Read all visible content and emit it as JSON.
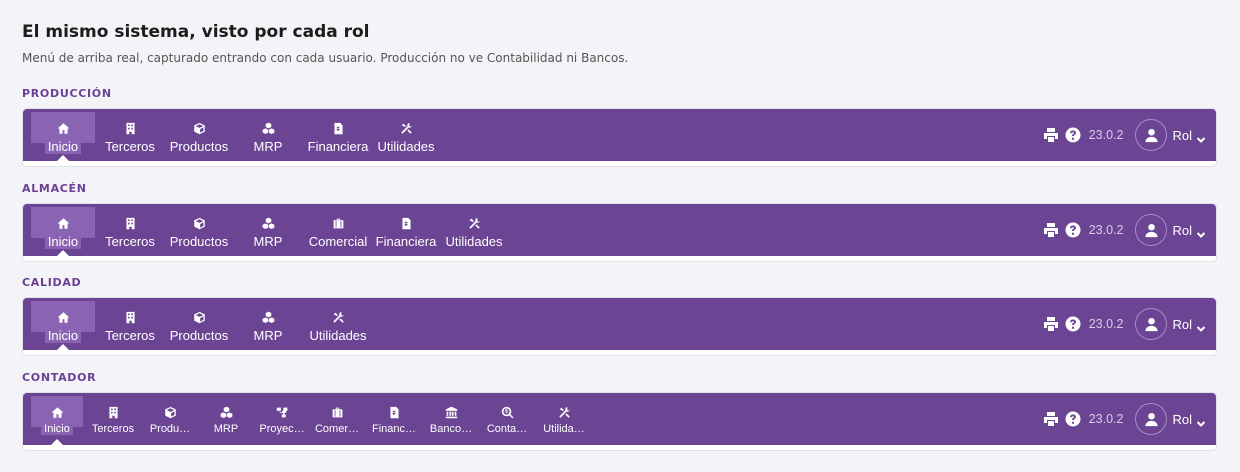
{
  "title": "El mismo sistema, visto por cada rol",
  "subtitle": "Menú de arriba real, capturado entrando con cada usuario. Producción no ve Contabilidad ni Bancos.",
  "colors": {
    "bar": "#6b4493",
    "active": "#8a64b3",
    "role_label": "#6b3f94"
  },
  "sections": [
    {
      "role": "PRODUCCIÓN",
      "items": [
        {
          "label": "Inicio",
          "icon": "home-icon"
        },
        {
          "label": "Terceros",
          "icon": "building-icon"
        },
        {
          "label": "Productos",
          "icon": "cube-icon"
        },
        {
          "label": "MRP",
          "icon": "cubes-icon"
        },
        {
          "label": "Financiera",
          "icon": "invoice-icon"
        },
        {
          "label": "Utilidades",
          "icon": "tools-icon"
        }
      ]
    },
    {
      "role": "ALMACÉN",
      "items": [
        {
          "label": "Inicio",
          "icon": "home-icon"
        },
        {
          "label": "Terceros",
          "icon": "building-icon"
        },
        {
          "label": "Productos",
          "icon": "cube-icon"
        },
        {
          "label": "MRP",
          "icon": "cubes-icon"
        },
        {
          "label": "Comercial",
          "icon": "briefcase-icon"
        },
        {
          "label": "Financiera",
          "icon": "invoice-icon"
        },
        {
          "label": "Utilidades",
          "icon": "tools-icon"
        }
      ]
    },
    {
      "role": "CALIDAD",
      "items": [
        {
          "label": "Inicio",
          "icon": "home-icon"
        },
        {
          "label": "Terceros",
          "icon": "building-icon"
        },
        {
          "label": "Productos",
          "icon": "cube-icon"
        },
        {
          "label": "MRP",
          "icon": "cubes-icon"
        },
        {
          "label": "Utilidades",
          "icon": "tools-icon"
        }
      ]
    },
    {
      "role": "CONTADOR",
      "items": [
        {
          "label": "Inicio",
          "icon": "home-icon"
        },
        {
          "label": "Terceros",
          "icon": "building-icon"
        },
        {
          "label": "Produ…",
          "icon": "cube-icon"
        },
        {
          "label": "MRP",
          "icon": "cubes-icon"
        },
        {
          "label": "Proyec…",
          "icon": "project-icon"
        },
        {
          "label": "Comer…",
          "icon": "briefcase-icon"
        },
        {
          "label": "Financ…",
          "icon": "invoice-icon"
        },
        {
          "label": "Banco…",
          "icon": "bank-icon"
        },
        {
          "label": "Conta…",
          "icon": "search-dollar-icon"
        },
        {
          "label": "Utilida…",
          "icon": "tools-icon"
        }
      ]
    }
  ],
  "topbar": {
    "version": "23.0.2",
    "user_label": "Rol"
  }
}
